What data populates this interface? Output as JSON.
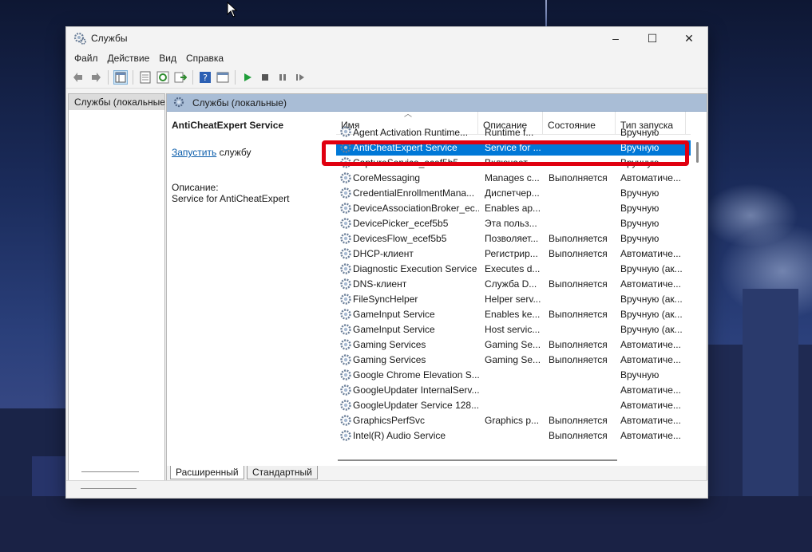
{
  "window": {
    "title": "Службы",
    "controls": [
      "–",
      "☐",
      "✕"
    ]
  },
  "menu": [
    "Файл",
    "Действие",
    "Вид",
    "Справка"
  ],
  "tree": {
    "root_label": "Службы (локальные)"
  },
  "panel": {
    "header": "Службы (локальные)",
    "selected_service": "AntiCheatExpert Service",
    "start_link": "Запустить",
    "start_suffix": " службу",
    "description_label": "Описание:",
    "description_text": "Service for AntiCheatExpert"
  },
  "columns": [
    "Имя",
    "Описание",
    "Состояние",
    "Тип запуска"
  ],
  "rows": [
    {
      "name": "Agent Activation Runtime...",
      "desc": "Runtime f...",
      "state": "",
      "start": "Вручную",
      "partial": true
    },
    {
      "name": "AntiCheatExpert Service",
      "desc": "Service for ...",
      "state": "",
      "start": "Вручную",
      "selected": true
    },
    {
      "name": "CaptureService_ecef5b5",
      "desc": "Включает ...",
      "state": "",
      "start": "Вручную"
    },
    {
      "name": "CoreMessaging",
      "desc": "Manages c...",
      "state": "Выполняется",
      "start": "Автоматиче..."
    },
    {
      "name": "CredentialEnrollmentMana...",
      "desc": "Диспетчер...",
      "state": "",
      "start": "Вручную"
    },
    {
      "name": "DeviceAssociationBroker_ec...",
      "desc": "Enables ap...",
      "state": "",
      "start": "Вручную"
    },
    {
      "name": "DevicePicker_ecef5b5",
      "desc": "Эта польз...",
      "state": "",
      "start": "Вручную"
    },
    {
      "name": "DevicesFlow_ecef5b5",
      "desc": "Позволяет...",
      "state": "Выполняется",
      "start": "Вручную"
    },
    {
      "name": "DHCP-клиент",
      "desc": "Регистрир...",
      "state": "Выполняется",
      "start": "Автоматиче..."
    },
    {
      "name": "Diagnostic Execution Service",
      "desc": "Executes d...",
      "state": "",
      "start": "Вручную (ак..."
    },
    {
      "name": "DNS-клиент",
      "desc": "Служба D...",
      "state": "Выполняется",
      "start": "Автоматиче..."
    },
    {
      "name": "FileSyncHelper",
      "desc": "Helper serv...",
      "state": "",
      "start": "Вручную (ак..."
    },
    {
      "name": "GameInput Service",
      "desc": "Enables ke...",
      "state": "Выполняется",
      "start": "Вручную (ак..."
    },
    {
      "name": "GameInput Service",
      "desc": "Host servic...",
      "state": "",
      "start": "Вручную (ак..."
    },
    {
      "name": "Gaming Services",
      "desc": "Gaming Se...",
      "state": "Выполняется",
      "start": "Автоматиче..."
    },
    {
      "name": "Gaming Services",
      "desc": "Gaming Se...",
      "state": "Выполняется",
      "start": "Автоматиче..."
    },
    {
      "name": "Google Chrome Elevation S...",
      "desc": "",
      "state": "",
      "start": "Вручную"
    },
    {
      "name": "GoogleUpdater InternalServ...",
      "desc": "",
      "state": "",
      "start": "Автоматиче..."
    },
    {
      "name": "GoogleUpdater Service 128....",
      "desc": "",
      "state": "",
      "start": "Автоматиче..."
    },
    {
      "name": "GraphicsPerfSvc",
      "desc": "Graphics p...",
      "state": "Выполняется",
      "start": "Автоматиче..."
    },
    {
      "name": "Intel(R) Audio Service",
      "desc": "",
      "state": "Выполняется",
      "start": "Автоматиче..."
    }
  ],
  "tabs": [
    "Расширенный",
    "Стандартный"
  ],
  "colors": {
    "selection": "#0078d7",
    "highlight_box": "#e00010",
    "panel_header": "#a9bdd6"
  }
}
